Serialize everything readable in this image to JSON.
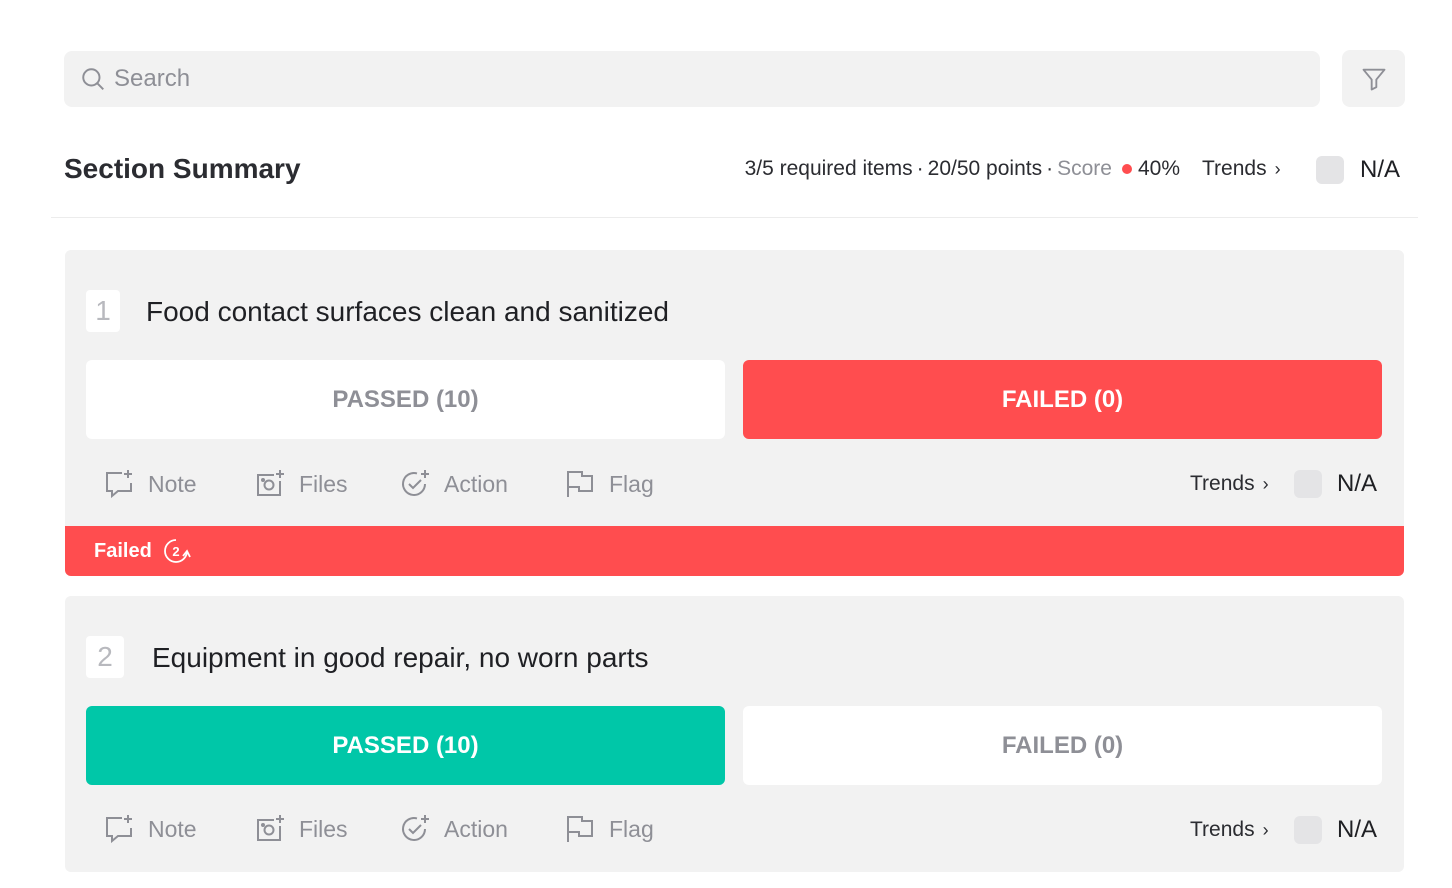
{
  "search": {
    "placeholder": "Search",
    "value": ""
  },
  "summary": {
    "title": "Section Summary",
    "required": "3/5 required items",
    "points": "20/50 points",
    "score_label": "Score",
    "score_value": "40%",
    "trends_label": "Trends",
    "na_label": "N/A"
  },
  "items": [
    {
      "number": "1",
      "question": "Food contact surfaces clean and sanitized",
      "passed_label": "PASSED (10)",
      "failed_label": "FAILED (0)",
      "selected": "failed",
      "actions": {
        "note": "Note",
        "files": "Files",
        "action": "Action",
        "flag": "Flag"
      },
      "trends_label": "Trends",
      "na_label": "N/A",
      "status_label": "Failed",
      "status_count": "2"
    },
    {
      "number": "2",
      "question": "Equipment in good repair, no worn parts",
      "passed_label": "PASSED (10)",
      "failed_label": "FAILED (0)",
      "selected": "passed",
      "actions": {
        "note": "Note",
        "files": "Files",
        "action": "Action",
        "flag": "Flag"
      },
      "trends_label": "Trends",
      "na_label": "N/A"
    }
  ],
  "colors": {
    "failed": "#ff4d4f",
    "passed": "#00c7a8",
    "muted": "#8e8f96",
    "panel": "#f2f2f2"
  }
}
